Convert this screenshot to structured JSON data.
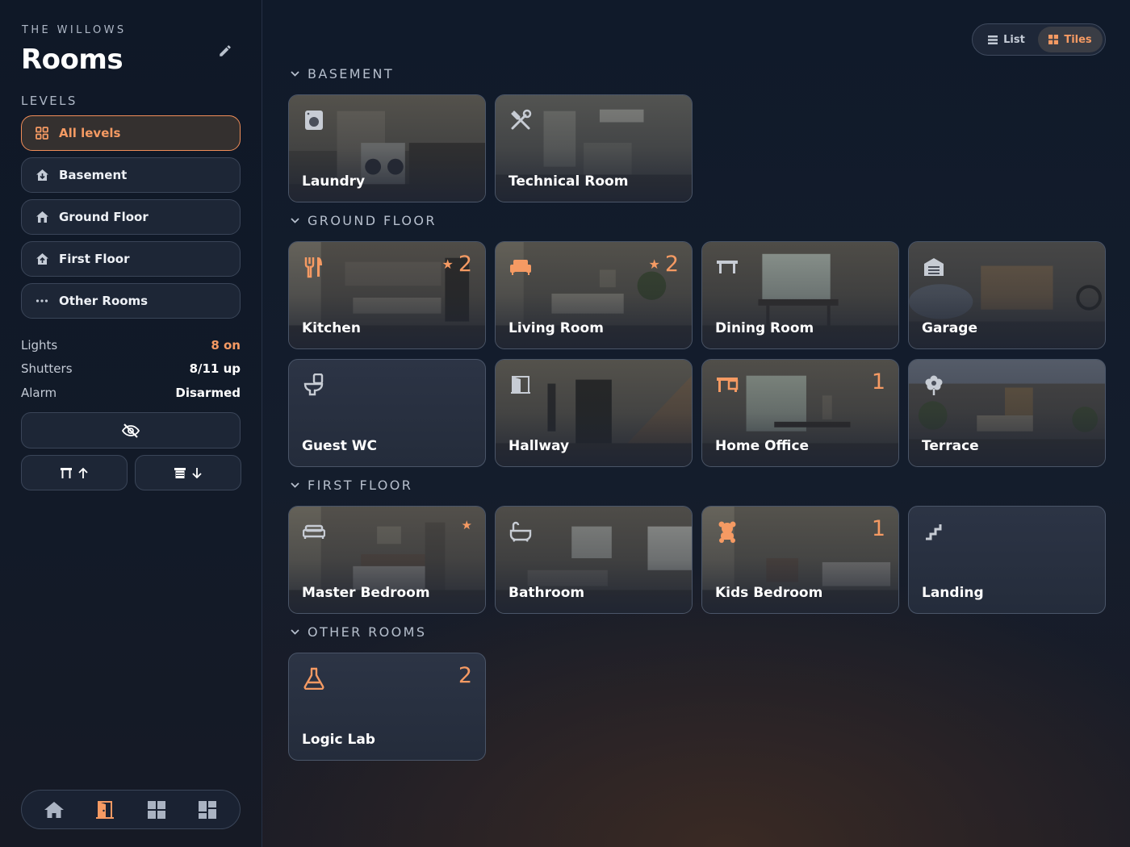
{
  "sidebar": {
    "home_name": "THE WILLOWS",
    "title": "Rooms",
    "levels_heading": "LEVELS",
    "levels": [
      {
        "label": "All levels",
        "icon": "grid-icon",
        "active": true
      },
      {
        "label": "Basement",
        "icon": "house-down-icon",
        "active": false
      },
      {
        "label": "Ground Floor",
        "icon": "house-icon",
        "active": false
      },
      {
        "label": "First Floor",
        "icon": "house-up-icon",
        "active": false
      },
      {
        "label": "Other Rooms",
        "icon": "ellipsis-icon",
        "active": false
      }
    ],
    "stats": [
      {
        "label": "Lights",
        "value": "8 on",
        "accent": true
      },
      {
        "label": "Shutters",
        "value": "8/11 up",
        "accent": false
      },
      {
        "label": "Alarm",
        "value": "Disarmed",
        "accent": false
      }
    ],
    "bottom_nav": [
      "home-icon",
      "door-icon",
      "grid-icon",
      "dashboard-icon"
    ]
  },
  "view_toggle": {
    "list_label": "List",
    "tiles_label": "Tiles",
    "selected": "Tiles"
  },
  "sections": [
    {
      "title": "BASEMENT",
      "rooms": [
        {
          "name": "Laundry",
          "icon": "washing-machine-icon"
        },
        {
          "name": "Technical Room",
          "icon": "tools-icon"
        }
      ]
    },
    {
      "title": "GROUND FLOOR",
      "rooms": [
        {
          "name": "Kitchen",
          "icon": "cutlery-icon",
          "count": "2",
          "favorite": true
        },
        {
          "name": "Living Room",
          "icon": "sofa-icon",
          "count": "2",
          "favorite": true
        },
        {
          "name": "Dining Room",
          "icon": "table-icon"
        },
        {
          "name": "Garage",
          "icon": "garage-icon"
        },
        {
          "name": "Guest WC",
          "icon": "toilet-icon"
        },
        {
          "name": "Hallway",
          "icon": "door-icon"
        },
        {
          "name": "Home Office",
          "icon": "desk-icon",
          "count": "1"
        },
        {
          "name": "Terrace",
          "icon": "flower-icon"
        }
      ]
    },
    {
      "title": "FIRST FLOOR",
      "rooms": [
        {
          "name": "Master Bedroom",
          "icon": "bed-icon",
          "favorite": true
        },
        {
          "name": "Bathroom",
          "icon": "bathtub-icon"
        },
        {
          "name": "Kids Bedroom",
          "icon": "teddy-icon",
          "count": "1"
        },
        {
          "name": "Landing",
          "icon": "stairs-icon"
        }
      ]
    },
    {
      "title": "OTHER ROOMS",
      "rooms": [
        {
          "name": "Logic Lab",
          "icon": "flask-icon",
          "count": "2"
        }
      ]
    }
  ],
  "colors": {
    "accent": "#f59a63",
    "background": "#121a28",
    "tile_border": "#4a5568"
  }
}
